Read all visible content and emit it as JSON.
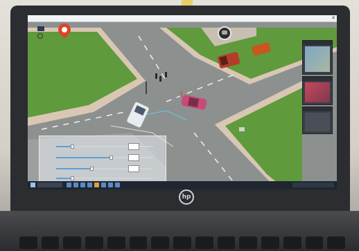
{
  "laptop": {
    "brand_logo": "hp"
  },
  "app": {
    "hud": {
      "location_icon": "map-pin-icon",
      "driver_icon": "driver-avatar-icon"
    },
    "side_panels": [
      {
        "name": "camera-view-1"
      },
      {
        "name": "camera-view-2"
      },
      {
        "name": "camera-view-3"
      }
    ],
    "sliders": [
      {
        "name": "slider-1",
        "level": 0.15
      },
      {
        "name": "slider-2",
        "level": 0.55
      },
      {
        "name": "slider-3",
        "level": 0.35
      },
      {
        "name": "slider-4",
        "level": 0.15
      }
    ]
  },
  "colors": {
    "grass": "#5f9a3c",
    "road": "#8c9190",
    "pin": "#d9452b",
    "car_pink": "#c84a78",
    "car_red": "#b43c2a",
    "car_orange": "#c8561e",
    "truck_white": "#e8ecef"
  }
}
